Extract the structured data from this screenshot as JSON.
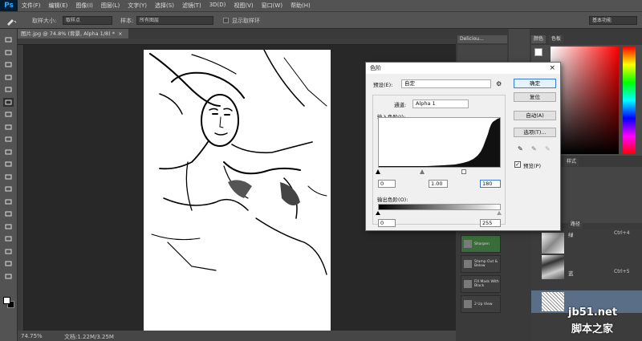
{
  "app": {
    "logo": "Ps"
  },
  "menu": [
    "文件(F)",
    "编辑(E)",
    "图像(I)",
    "图层(L)",
    "文字(Y)",
    "选择(S)",
    "滤镜(T)",
    "3D(D)",
    "视图(V)",
    "窗口(W)",
    "帮助(H)"
  ],
  "options": {
    "sample_size_label": "取样大小:",
    "sample_size_value": "取样点",
    "sample_label": "样本:",
    "sample_value": "所有图层",
    "show_ring_label": "显示取样环",
    "workspace": "基本功能"
  },
  "document": {
    "tab_title": "图片.jpg @ 74.8% (背景, Alpha 1/8) *",
    "tab_close": "×"
  },
  "status": {
    "zoom": "74.75%",
    "doc_size": "文档:1.22M/3.25M"
  },
  "right_dock": {
    "panel_delicious": "Deliciou...",
    "color_tab": "颜色",
    "swatches_tab": "色板",
    "styles_tab": "样式",
    "paths_tab": "路径",
    "layer_shortcuts": [
      "Ctrl+4",
      "Ctrl+5"
    ],
    "layer_names": [
      "绿",
      "蓝"
    ],
    "actions": [
      "Sharpen",
      "Stamp Out & Below",
      "Fill Mask With Black",
      "2 Up View"
    ]
  },
  "dialog": {
    "title": "色阶",
    "close": "×",
    "preset_label": "预设(E):",
    "preset_value": "自定",
    "channel_label": "通道:",
    "channel_value": "Alpha 1",
    "input_levels_label": "输入色阶(I):",
    "input_black": "0",
    "input_mid": "1.00",
    "input_white": "180",
    "output_levels_label": "输出色阶(O):",
    "output_black": "0",
    "output_white": "255",
    "ok": "确定",
    "reset": "复位",
    "auto": "自动(A)",
    "options": "选项(T)...",
    "preview_label": "预览(P)",
    "preview_checked": true
  },
  "watermark": {
    "line1": "jb51.net",
    "line2": "脚本之家"
  }
}
